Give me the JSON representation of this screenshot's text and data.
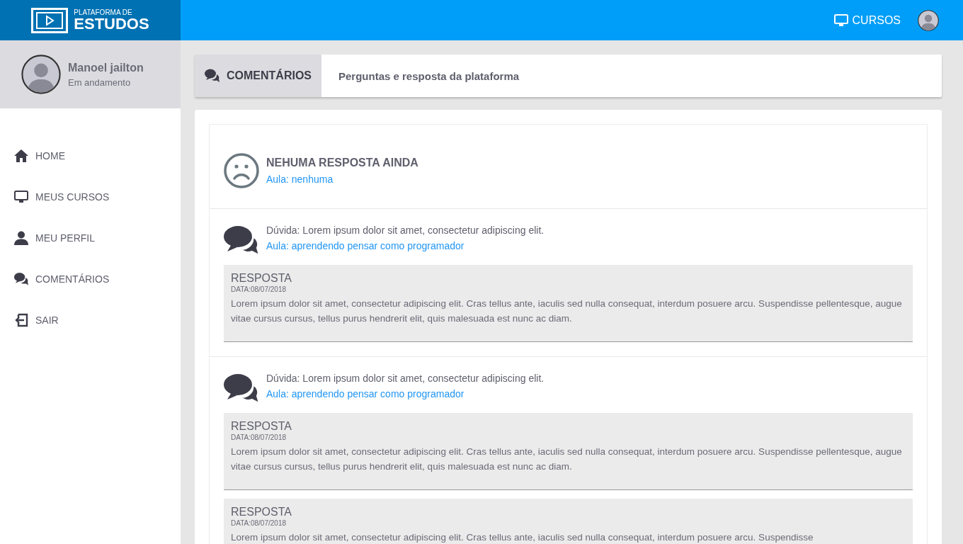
{
  "brand": {
    "line1": "PLATAFORMA DE",
    "line2": "ESTUDOS"
  },
  "topbar": {
    "link": "CURSOS"
  },
  "user": {
    "name": "Manoel jailton",
    "status": "Em andamento"
  },
  "sidebar": {
    "items": [
      {
        "label": "HOME",
        "kind": "home"
      },
      {
        "label": "MEUS CURSOS",
        "kind": "monitor"
      },
      {
        "label": "MEU PERFIL",
        "kind": "user"
      },
      {
        "label": "COMENTÁRIOS",
        "kind": "comments"
      },
      {
        "label": "SAIR",
        "kind": "exit"
      }
    ]
  },
  "header": {
    "tab": "COMENTÁRIOS",
    "subtitle": "Perguntas e resposta da plataforma"
  },
  "threads": [
    {
      "kind": "empty",
      "title": "NEHUMA RESPOSTA AINDA",
      "lesson": "Aula: nenhuma"
    },
    {
      "kind": "question",
      "title": "Dúvida: Lorem ipsum dolor sit amet, consectetur adipiscing elit.",
      "lesson": "Aula: aprendendo pensar como programador",
      "answers": [
        {
          "heading": "RESPOSTA",
          "date": "DATA:08/07/2018",
          "text": "Lorem ipsum dolor sit amet, consectetur adipiscing elit. Cras tellus ante, iaculis sed nulla consequat, interdum posuere arcu. Suspendisse pellentesque, augue vitae cursus cursus, tellus purus hendrerit elit, quis malesuada est nunc ac diam."
        }
      ]
    },
    {
      "kind": "question",
      "title": "Dúvida: Lorem ipsum dolor sit amet, consectetur adipiscing elit.",
      "lesson": "Aula: aprendendo pensar como programador",
      "answers": [
        {
          "heading": "RESPOSTA",
          "date": "DATA:08/07/2018",
          "text": "Lorem ipsum dolor sit amet, consectetur adipiscing elit. Cras tellus ante, iaculis sed nulla consequat, interdum posuere arcu. Suspendisse pellentesque, augue vitae cursus cursus, tellus purus hendrerit elit, quis malesuada est nunc ac diam."
        },
        {
          "heading": "RESPOSTA",
          "date": "DATA:08/07/2018",
          "text": "Lorem ipsum dolor sit amet, consectetur adipiscing elit. Cras tellus ante, iaculis sed nulla consequat, interdum posuere arcu. Suspendisse"
        }
      ]
    }
  ]
}
